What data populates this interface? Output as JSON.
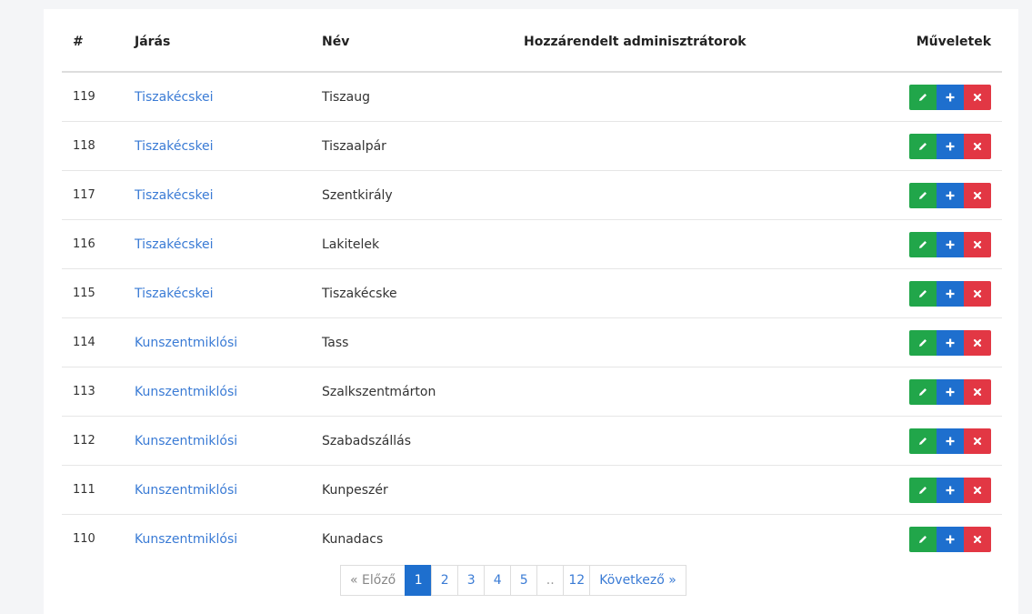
{
  "table": {
    "headers": {
      "id": "#",
      "jaras": "Járás",
      "nev": "Név",
      "admins": "Hozzárendelt adminisztrátorok",
      "actions": "Műveletek"
    },
    "rows": [
      {
        "id": "119",
        "jaras": "Tiszakécskei",
        "nev": "Tiszaug",
        "admins": ""
      },
      {
        "id": "118",
        "jaras": "Tiszakécskei",
        "nev": "Tiszaalpár",
        "admins": ""
      },
      {
        "id": "117",
        "jaras": "Tiszakécskei",
        "nev": "Szentkirály",
        "admins": ""
      },
      {
        "id": "116",
        "jaras": "Tiszakécskei",
        "nev": "Lakitelek",
        "admins": ""
      },
      {
        "id": "115",
        "jaras": "Tiszakécskei",
        "nev": "Tiszakécske",
        "admins": ""
      },
      {
        "id": "114",
        "jaras": "Kunszentmiklósi",
        "nev": "Tass",
        "admins": ""
      },
      {
        "id": "113",
        "jaras": "Kunszentmiklósi",
        "nev": "Szalkszentmárton",
        "admins": ""
      },
      {
        "id": "112",
        "jaras": "Kunszentmiklósi",
        "nev": "Szabadszállás",
        "admins": ""
      },
      {
        "id": "111",
        "jaras": "Kunszentmiklósi",
        "nev": "Kunpeszér",
        "admins": ""
      },
      {
        "id": "110",
        "jaras": "Kunszentmiklósi",
        "nev": "Kunadacs",
        "admins": ""
      }
    ],
    "row_actions": {
      "edit_icon": "pencil-icon",
      "add_icon": "plus-icon",
      "delete_icon": "close-icon"
    }
  },
  "pagination": {
    "prev_label": "« Előző",
    "pages": [
      "1",
      "2",
      "3",
      "4",
      "5",
      "..",
      "12"
    ],
    "active_page": "1",
    "next_label": "Következő »"
  },
  "colors": {
    "link": "#3a7bd5",
    "edit": "#21a64a",
    "add": "#1e6fce",
    "delete": "#e23744",
    "active_page": "#1e6fce"
  }
}
